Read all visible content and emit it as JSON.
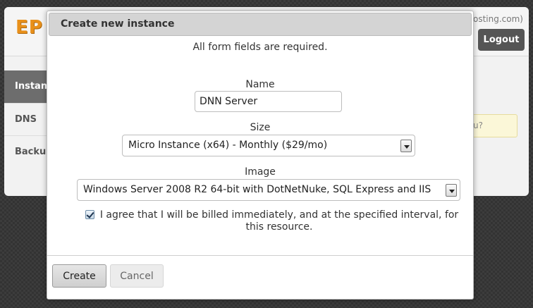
{
  "app": {
    "logo": "EP",
    "account_text": "hosting.com)",
    "logout_label": "Logout",
    "sidebar": [
      {
        "label": "Instances"
      },
      {
        "label": "DNS"
      },
      {
        "label": "Backups"
      }
    ],
    "hint_text": "u?"
  },
  "modal": {
    "title": "Create new instance",
    "notice": "All form fields are required.",
    "name_label": "Name",
    "name_value": "DNN Server",
    "size_label": "Size",
    "size_value": "Micro Instance (x64) - Monthly ($29/mo)",
    "image_label": "Image",
    "image_value": "Windows Server 2008 R2 64-bit with DotNetNuke, SQL Express and IIS",
    "agree_checked": true,
    "agree_text": "I agree that I will be billed immediately, and at the specified interval, for this resource.",
    "create_label": "Create",
    "cancel_label": "Cancel"
  }
}
